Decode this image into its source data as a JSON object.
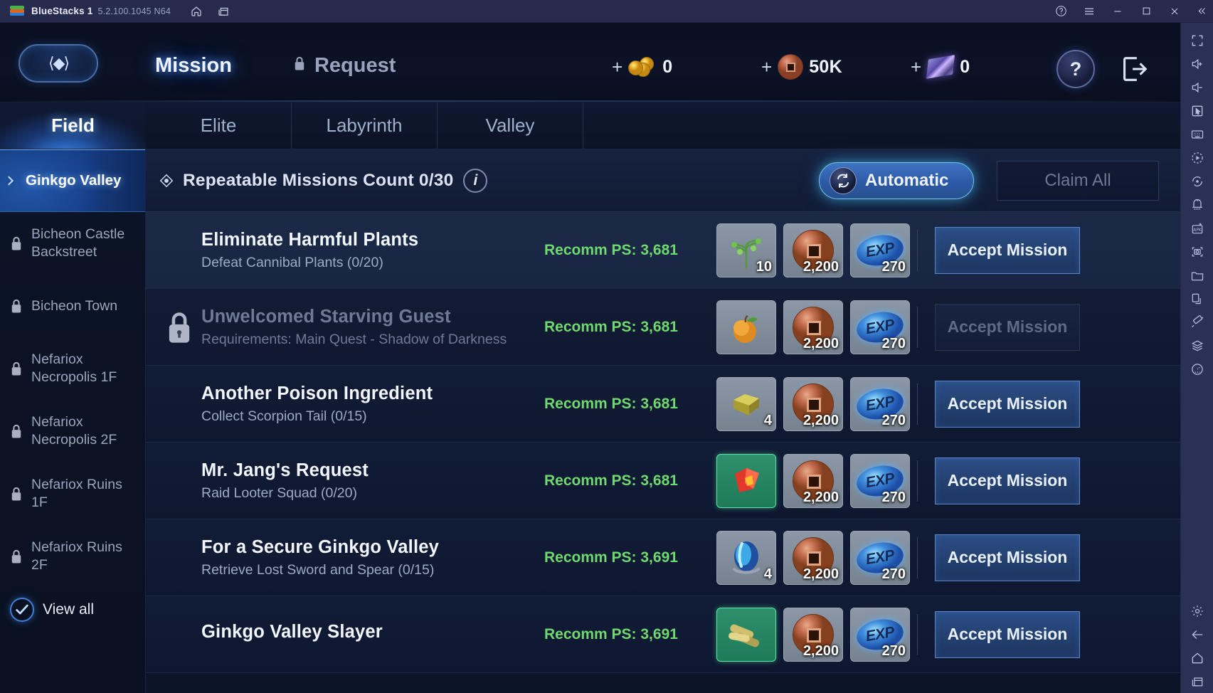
{
  "titlebar": {
    "app_name": "BlueStacks 1",
    "version": "5.2.100.1045 N64",
    "icons": [
      "home-icon",
      "multi-window-icon"
    ],
    "right_icons": [
      "help-circle-icon",
      "hamburger-menu-icon",
      "minimize-icon",
      "maximize-icon",
      "close-icon",
      "collapse-icon"
    ]
  },
  "rail": {
    "icons": [
      "fullscreen-icon",
      "volume-up-icon",
      "volume-down-icon",
      "pointer-icon",
      "keyboard-icon",
      "macro-record-icon",
      "sync-rotate-icon",
      "game-controls-icon",
      "install-apk-icon",
      "screenshot-icon",
      "media-folder-icon",
      "multi-instance-icon",
      "trim-icon",
      "layers-icon",
      "eco-mode-icon"
    ],
    "bottom_icons": [
      "settings-gear-icon",
      "back-arrow-icon",
      "home-icon",
      "recents-icon"
    ]
  },
  "header": {
    "emblem": "guild-emblem-icon",
    "tabs": [
      {
        "label": "Mission",
        "active": true,
        "locked": false
      },
      {
        "label": "Request",
        "active": false,
        "locked": true
      }
    ],
    "currencies": [
      {
        "icon": "gold-coins-icon",
        "value": "0"
      },
      {
        "icon": "copper-coin-icon",
        "value": "50K"
      },
      {
        "icon": "purple-ingot-icon",
        "value": "0"
      }
    ],
    "plus_label": "+",
    "help_label": "?",
    "exit_label": "exit-door-icon"
  },
  "zone_tabs": [
    {
      "label": "Field",
      "active": true
    },
    {
      "label": "Elite",
      "active": false
    },
    {
      "label": "Labyrinth",
      "active": false
    },
    {
      "label": "Valley",
      "active": false
    }
  ],
  "zone_list": {
    "items": [
      {
        "label": "Ginkgo Valley",
        "locked": false,
        "selected": true
      },
      {
        "label": "Bicheon Castle Backstreet",
        "locked": true,
        "selected": false
      },
      {
        "label": "Bicheon Town",
        "locked": true,
        "selected": false
      },
      {
        "label": "Nefariox Necropolis 1F",
        "locked": true,
        "selected": false
      },
      {
        "label": "Nefariox Necropolis 2F",
        "locked": true,
        "selected": false
      },
      {
        "label": "Nefariox Ruins 1F",
        "locked": true,
        "selected": false
      },
      {
        "label": "Nefariox Ruins 2F",
        "locked": true,
        "selected": false
      }
    ],
    "view_all_label": "View all"
  },
  "mission_panel": {
    "count_label": "Repeatable Missions Count 0/30",
    "info_label": "i",
    "automatic_label": "Automatic",
    "claim_all_label": "Claim All",
    "accept_label": "Accept Mission",
    "missions": [
      {
        "title": "Eliminate Harmful Plants",
        "subtitle": "Defeat Cannibal Plants (0/20)",
        "recomm": "Recomm PS: 3,681",
        "locked": false,
        "highlighted": true,
        "rewards": [
          {
            "icon": "plant-sprout-icon",
            "count": "10",
            "rare": false
          },
          {
            "icon": "copper-coin-icon",
            "count": "2,200",
            "rare": false
          },
          {
            "icon": "exp-orb-icon",
            "count": "270",
            "rare": false
          }
        ]
      },
      {
        "title": "Unwelcomed Starving Guest",
        "subtitle": "Requirements: Main Quest - Shadow of Darkness",
        "recomm": "Recomm PS: 3,681",
        "locked": true,
        "highlighted": false,
        "rewards": [
          {
            "icon": "orange-fruit-icon",
            "count": "",
            "rare": false
          },
          {
            "icon": "copper-coin-icon",
            "count": "2,200",
            "rare": false
          },
          {
            "icon": "exp-orb-icon",
            "count": "270",
            "rare": false
          }
        ]
      },
      {
        "title": "Another Poison Ingredient",
        "subtitle": "Collect Scorpion Tail (0/15)",
        "recomm": "Recomm PS: 3,681",
        "locked": false,
        "highlighted": false,
        "rewards": [
          {
            "icon": "gold-ore-icon",
            "count": "4",
            "rare": false
          },
          {
            "icon": "copper-coin-icon",
            "count": "2,200",
            "rare": false
          },
          {
            "icon": "exp-orb-icon",
            "count": "270",
            "rare": false
          }
        ]
      },
      {
        "title": "Mr. Jang's Request",
        "subtitle": "Raid Looter Squad (0/20)",
        "recomm": "Recomm PS: 3,681",
        "locked": false,
        "highlighted": false,
        "rewards": [
          {
            "icon": "red-crystal-icon",
            "count": "",
            "rare": true
          },
          {
            "icon": "copper-coin-icon",
            "count": "2,200",
            "rare": false
          },
          {
            "icon": "exp-orb-icon",
            "count": "270",
            "rare": false
          }
        ]
      },
      {
        "title": "For a Secure Ginkgo Valley",
        "subtitle": "Retrieve Lost Sword and Spear (0/15)",
        "recomm": "Recomm PS: 3,691",
        "locked": false,
        "highlighted": false,
        "rewards": [
          {
            "icon": "blue-egg-icon",
            "count": "4",
            "rare": false
          },
          {
            "icon": "copper-coin-icon",
            "count": "2,200",
            "rare": false
          },
          {
            "icon": "exp-orb-icon",
            "count": "270",
            "rare": false
          }
        ]
      },
      {
        "title": "Ginkgo Valley Slayer",
        "subtitle": "",
        "recomm": "Recomm PS: 3,691",
        "locked": false,
        "highlighted": false,
        "rewards": [
          {
            "icon": "gold-scrolls-icon",
            "count": "",
            "rare": true
          },
          {
            "icon": "copper-coin-icon",
            "count": "2,200",
            "rare": false
          },
          {
            "icon": "exp-orb-icon",
            "count": "270",
            "rare": false
          }
        ]
      }
    ]
  },
  "colors": {
    "accent_blue": "#3f74c4",
    "glow_cyan": "#6fc4e8",
    "recomm_green": "#6fd86f",
    "titlebar": "#262b4e",
    "rail": "#2b3055",
    "rare_green": "#5fe3a8"
  }
}
